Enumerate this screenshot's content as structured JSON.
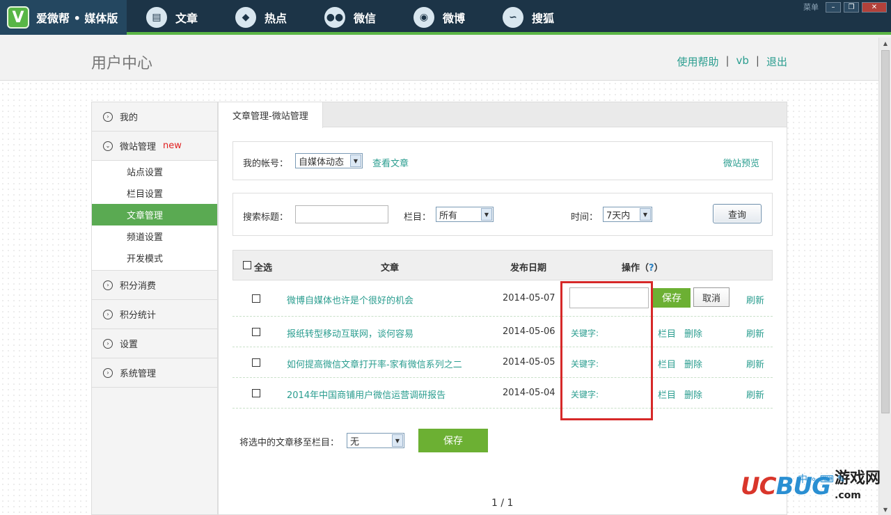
{
  "app": {
    "brand_logo": "V",
    "brand_name": "爱微帮 • 媒体版",
    "nav": [
      {
        "label": "文章",
        "icon": "document-icon"
      },
      {
        "label": "热点",
        "icon": "diamond-icon"
      },
      {
        "label": "微信",
        "icon": "wechat-icon"
      },
      {
        "label": "微博",
        "icon": "weibo-icon"
      },
      {
        "label": "搜狐",
        "icon": "sohu-icon"
      }
    ],
    "menu_label": "菜单"
  },
  "header": {
    "title": "用户中心",
    "help": "使用帮助",
    "user": "vb",
    "logout": "退出",
    "separator": "|"
  },
  "sidebar": {
    "mine": "我的",
    "site_mgmt": "微站管理",
    "new_badge": "new",
    "sub_items": [
      "站点设置",
      "栏目设置",
      "文章管理",
      "频道设置",
      "开发模式"
    ],
    "active_sub": "文章管理",
    "points_spend": "积分消费",
    "points_stats": "积分统计",
    "settings": "设置",
    "system": "系统管理"
  },
  "main": {
    "tab": "文章管理-微站管理",
    "account_label": "我的帐号：",
    "account_value": "自媒体动态",
    "view_articles": "查看文章",
    "preview": "微站预览",
    "search_label": "搜索标题：",
    "column_label": "栏目：",
    "column_value": "所有",
    "time_label": "时间：",
    "time_value": "7天内",
    "query_btn": "查询"
  },
  "table": {
    "select_all": "全选",
    "col_article": "文章",
    "col_date": "发布日期",
    "col_ops": "操作（",
    "col_ops_q": "?",
    "col_ops_end": "）",
    "save_btn": "保存",
    "cancel_btn": "取消",
    "keyword_label": "关键字:",
    "column_link": "栏目",
    "delete_link": "删除",
    "refresh_link": "刷新",
    "rows": [
      {
        "title": "微博自媒体也许是个很好的机会",
        "date": "2014-05-07"
      },
      {
        "title": "报纸转型移动互联网，谈何容易",
        "date": "2014-05-06"
      },
      {
        "title": "如何提高微信文章打开率-家有微信系列之二",
        "date": "2014-05-05"
      },
      {
        "title": "2014年中国商铺用户微信运营调研报告",
        "date": "2014-05-04"
      }
    ]
  },
  "footer": {
    "move_label": "将选中的文章移至栏目：",
    "move_value": "无",
    "save_btn": "保存",
    "pager": "1 / 1"
  },
  "watermark": {
    "uc": "UC",
    "bug": "BUG",
    "cn": "游戏网",
    "domain": ".com",
    "tools": "中 ∘ ⌨ ✎"
  },
  "colors": {
    "topbar": "#1c3447",
    "accent_green": "#5bb646",
    "link_teal": "#2a9d8f",
    "highlight_red": "#d62828"
  }
}
